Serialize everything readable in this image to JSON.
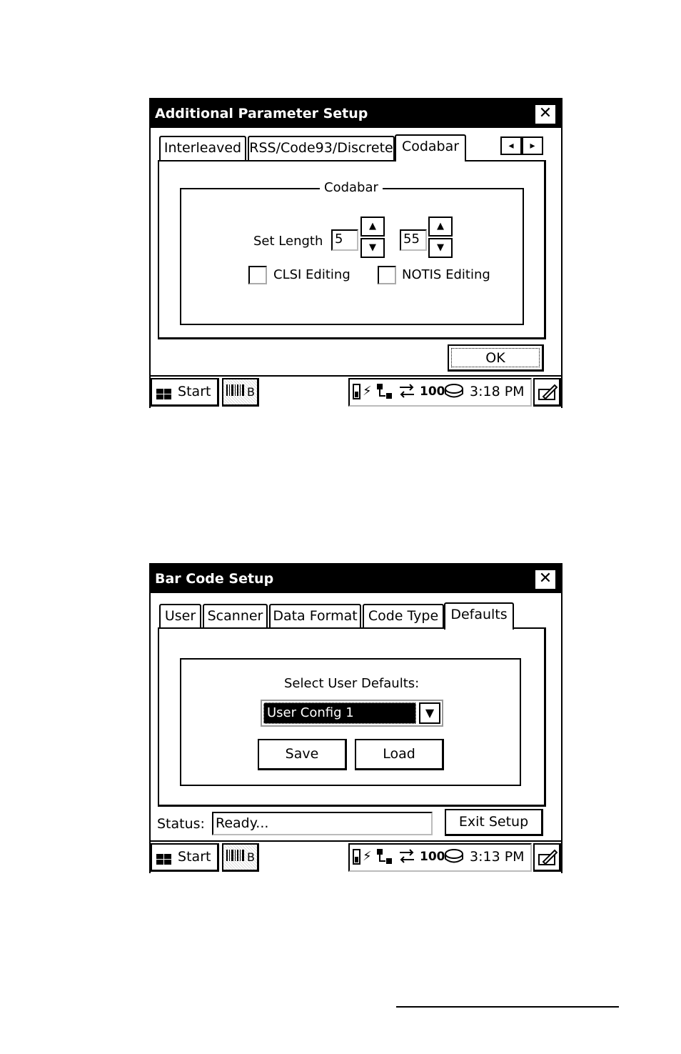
{
  "window1": {
    "title": "Additional Parameter Setup",
    "close": "✕",
    "tabs": [
      {
        "label": "Interleaved"
      },
      {
        "label": "RSS/Code93/Discrete"
      },
      {
        "label": "Codabar"
      }
    ],
    "scroll_left": "◂",
    "scroll_right": "▸",
    "group_title": "Codabar",
    "set_length_label": "Set Length",
    "min_length": "5",
    "max_length": "55",
    "spin_up": "▲",
    "spin_down": "▼",
    "clsi_label": "CLSI Editing",
    "notis_label": "NOTIS Editing",
    "ok_label": "OK",
    "taskbar": {
      "start_label": "Start",
      "app_label": "B",
      "time": "3:18 PM",
      "tray_100": "100"
    }
  },
  "window2": {
    "title": "Bar Code Setup",
    "close": "✕",
    "tabs": [
      {
        "label": "User"
      },
      {
        "label": "Scanner"
      },
      {
        "label": "Data Format"
      },
      {
        "label": "Code Type"
      },
      {
        "label": "Defaults"
      }
    ],
    "select_label": "Select User Defaults:",
    "select_value": "User Config 1",
    "dropdown_arrow": "▼",
    "save_label": "Save",
    "load_label": "Load",
    "status_label": "Status:",
    "status_value": "Ready...",
    "exit_label": "Exit Setup",
    "taskbar": {
      "start_label": "Start",
      "app_label": "B",
      "time": "3:13 PM",
      "tray_100": "100"
    }
  }
}
